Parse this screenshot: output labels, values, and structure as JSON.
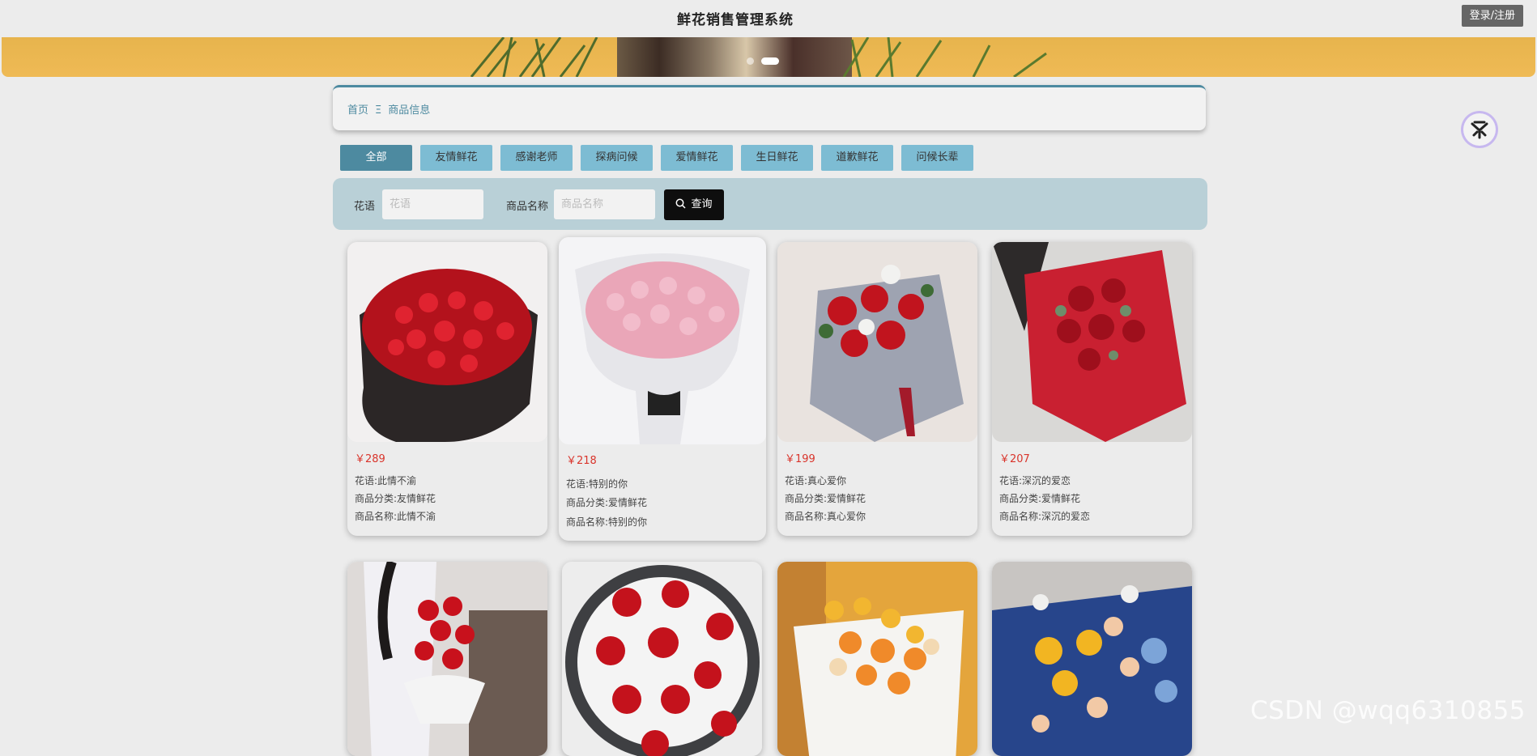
{
  "header": {
    "title": "鲜花销售管理系统",
    "login_label": "登录/注册"
  },
  "banner": {
    "slides_count": 2,
    "active_slide": 2
  },
  "breadcrumb": {
    "home": "首页",
    "separator": "Ξ",
    "current": "商品信息"
  },
  "categories": [
    {
      "label": "全部",
      "active": true
    },
    {
      "label": "友情鲜花",
      "active": false
    },
    {
      "label": "感谢老师",
      "active": false
    },
    {
      "label": "探病问候",
      "active": false
    },
    {
      "label": "爱情鲜花",
      "active": false
    },
    {
      "label": "生日鲜花",
      "active": false
    },
    {
      "label": "道歉鲜花",
      "active": false
    },
    {
      "label": "问候长辈",
      "active": false
    }
  ],
  "search": {
    "flower_label": "花语",
    "flower_placeholder": "花语",
    "name_label": "商品名称",
    "name_placeholder": "商品名称",
    "query_label": "查询"
  },
  "products": [
    {
      "price": "￥289",
      "flower_lang": "花语:此情不渝",
      "category": "商品分类:友情鲜花",
      "name": "商品名称:此情不渝"
    },
    {
      "price": "￥218",
      "flower_lang": "花语:特别的你",
      "category": "商品分类:爱情鲜花",
      "name": "商品名称:特别的你"
    },
    {
      "price": "￥199",
      "flower_lang": "花语:真心爱你",
      "category": "商品分类:爱情鲜花",
      "name": "商品名称:真心爱你"
    },
    {
      "price": "￥207",
      "flower_lang": "花语:深沉的爱恋",
      "category": "商品分类:爱情鲜花",
      "name": "商品名称:深沉的爱恋"
    },
    {
      "price": "",
      "flower_lang": "",
      "category": "",
      "name": ""
    },
    {
      "price": "",
      "flower_lang": "",
      "category": "",
      "name": ""
    },
    {
      "price": "",
      "flower_lang": "",
      "category": "",
      "name": ""
    },
    {
      "price": "",
      "flower_lang": "",
      "category": "",
      "name": ""
    }
  ],
  "watermark": "CSDN @wqq6310855",
  "colors": {
    "accent": "#4d8aa0",
    "tab": "#7dbcd3",
    "search_bg": "#b9d0d7",
    "price": "#d9342b",
    "banner": "#efba55"
  }
}
